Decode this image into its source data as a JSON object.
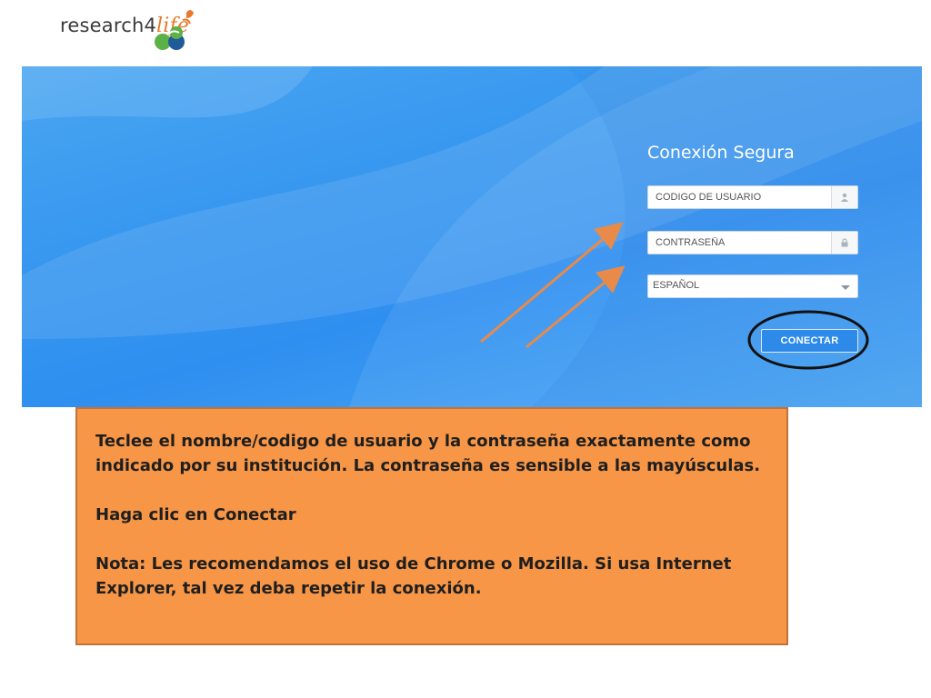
{
  "logo": {
    "text_main": "research",
    "text_four": "4",
    "text_life": "life"
  },
  "login": {
    "title": "Conexión Segura",
    "username_placeholder": "CODIGO DE USUARIO",
    "password_placeholder": "CONTRASEÑA",
    "language_value": "ESPAÑOL",
    "connect_label": "CONECTAR"
  },
  "icons": {
    "username": "user-icon",
    "password": "lock-icon",
    "language": "chevron-down-icon"
  },
  "colors": {
    "panel_blue": "#3797ef",
    "button_blue": "#2d8ae8",
    "note_orange": "#f79646",
    "arrow_orange": "#e88a4a",
    "highlight_ring": "#111111"
  },
  "instructions": {
    "line1": "Teclee el nombre/codigo de usuario y la contraseña exactamente como indicado por su institución. La contraseña es sensible a las mayúsculas.",
    "line2": "Haga clic en Conectar",
    "line3": "Nota: Les recomendamos el uso de Chrome o Mozilla.  Si usa Internet Explorer, tal vez deba repetir la conexión."
  }
}
